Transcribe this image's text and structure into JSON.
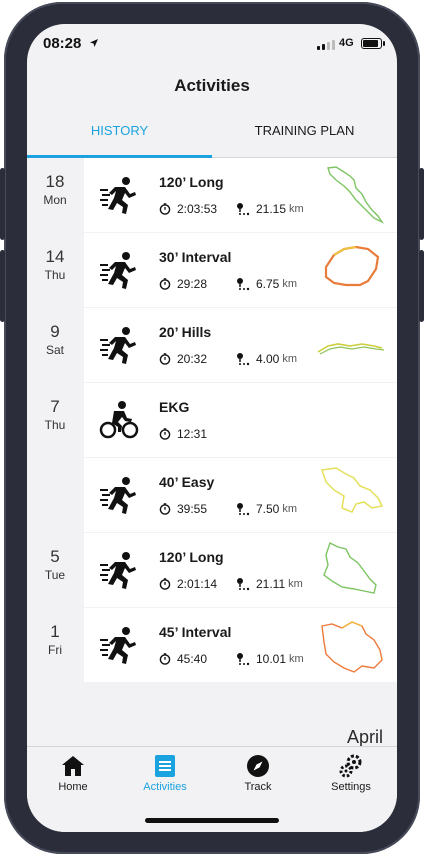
{
  "status_bar": {
    "time": "08:28",
    "network": "4G"
  },
  "header": {
    "title": "Activities"
  },
  "tabs": [
    {
      "label": "HISTORY",
      "active": true
    },
    {
      "label": "TRAINING PLAN",
      "active": false
    }
  ],
  "activities": [
    {
      "day": "18",
      "dow": "Mon",
      "type": "run-icon",
      "title": "120’ Long",
      "duration": "2:03:53",
      "distance": "21.15",
      "unit": "km"
    },
    {
      "day": "14",
      "dow": "Thu",
      "type": "run-icon",
      "title": "30’ Interval",
      "duration": "29:28",
      "distance": "6.75",
      "unit": "km"
    },
    {
      "day": "9",
      "dow": "Sat",
      "type": "run-icon",
      "title": "20’ Hills",
      "duration": "20:32",
      "distance": "4.00",
      "unit": "km"
    },
    {
      "day": "7",
      "dow": "Thu",
      "type": "cycling-icon",
      "title": "EKG",
      "duration": "12:31",
      "distance": "",
      "unit": ""
    },
    {
      "day": "",
      "dow": "",
      "type": "run-icon",
      "title": "40’ Easy",
      "duration": "39:55",
      "distance": "7.50",
      "unit": "km"
    },
    {
      "day": "5",
      "dow": "Tue",
      "type": "run-icon",
      "title": "120’ Long",
      "duration": "2:01:14",
      "distance": "21.11",
      "unit": "km"
    },
    {
      "day": "1",
      "dow": "Fri",
      "type": "run-icon",
      "title": "45’ Interval",
      "duration": "45:40",
      "distance": "10.01",
      "unit": "km"
    }
  ],
  "month_label": "April",
  "bottom_nav": [
    {
      "label": "Home",
      "icon": "home-icon",
      "active": false
    },
    {
      "label": "Activities",
      "icon": "list-icon",
      "active": true
    },
    {
      "label": "Track",
      "icon": "compass-icon",
      "active": false
    },
    {
      "label": "Settings",
      "icon": "gears-icon",
      "active": false
    }
  ],
  "colors": {
    "accent": "#1aa3df",
    "background": "#f2f2f4",
    "card": "#ffffff"
  }
}
